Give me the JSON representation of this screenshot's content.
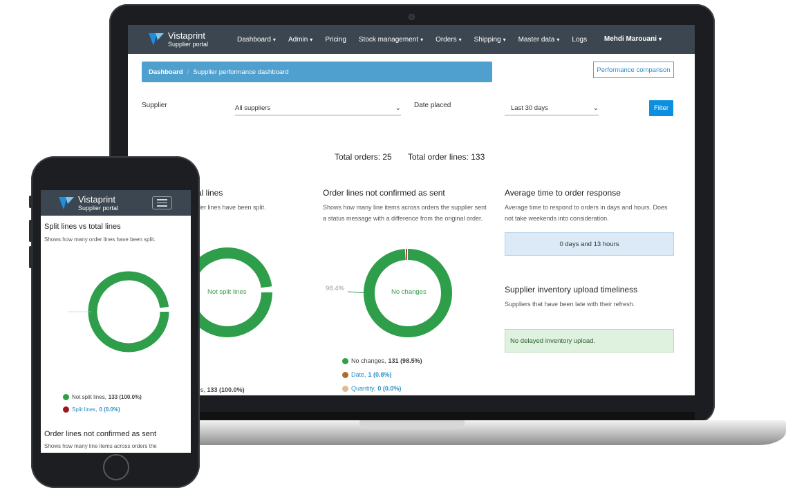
{
  "brand": {
    "name": "Vistaprint",
    "sub": "Supplier portal"
  },
  "nav": {
    "items": [
      {
        "label": "Dashboard",
        "dropdown": true
      },
      {
        "label": "Admin",
        "dropdown": true
      },
      {
        "label": "Pricing",
        "dropdown": false
      },
      {
        "label": "Stock management",
        "dropdown": true
      },
      {
        "label": "Orders",
        "dropdown": true
      },
      {
        "label": "Shipping",
        "dropdown": true
      },
      {
        "label": "Master data",
        "dropdown": true
      },
      {
        "label": "Logs",
        "dropdown": false
      }
    ],
    "user": "Mehdi Marouani"
  },
  "breadcrumb": {
    "root": "Dashboard",
    "separator": "/",
    "current": "Supplier performance dashboard"
  },
  "perf_button": "Performance comparison",
  "filters": {
    "supplier_label": "Supplier",
    "supplier_value": "All suppliers",
    "date_label": "Date placed",
    "date_value": "Last 30 days",
    "filter_button": "Filter"
  },
  "totals": {
    "orders": "Total orders: 25",
    "order_lines": "Total order lines: 133"
  },
  "split_card": {
    "title_partial": "al lines",
    "desc_partial": "der lines have been split.",
    "donut_label": "Not split lines",
    "legend_partial_prefix": "es,",
    "legend_partial_value": "133 (100.0%)"
  },
  "changes_card": {
    "title": "Order lines not confirmed as sent",
    "desc_line1": "Shows how many line items across orders the supplier sent",
    "desc_line2": "a status message with a difference from the original order.",
    "donut_label": "No changes",
    "pct_label": "98.4%",
    "legend": [
      {
        "label": "No changes,",
        "value": "131 (98.5%)",
        "color": "#2f9e4a",
        "link": false
      },
      {
        "label": "Date,",
        "value": "1 (0.8%)",
        "color": "#b06a2a",
        "link": true
      },
      {
        "label": "Quantity,",
        "value": "0 (0.0%)",
        "color": "#e3b98e",
        "link": true
      }
    ],
    "chart_data": {
      "type": "pie",
      "categories": [
        "No changes",
        "Date",
        "Quantity"
      ],
      "values": [
        131,
        1,
        0
      ]
    }
  },
  "response_card": {
    "title": "Average time to order response",
    "desc_line1": "Average time to respond to orders in days and hours. Does",
    "desc_line2": "not take weekends into consideration.",
    "value": "0 days and 13 hours"
  },
  "inventory_card": {
    "title": "Supplier inventory upload timeliness",
    "desc": "Suppliers that have been late with their refresh.",
    "status": "No delayed inventory upload."
  },
  "mobile": {
    "split_title": "Split lines vs total lines",
    "split_desc": "Shows how many order lines have been split.",
    "legend": [
      {
        "label": "Not split lines,",
        "value": "133 (100.0%)",
        "color": "#2f9e4a",
        "link": false
      },
      {
        "label": "Split lines,",
        "value": "0 (0.0%)",
        "color": "#a3141e",
        "link": true
      }
    ],
    "next_title": "Order lines not confirmed as sent",
    "next_desc": "Shows how many line items across orders the",
    "chart_data": {
      "type": "pie",
      "categories": [
        "Not split lines",
        "Split lines"
      ],
      "values": [
        133,
        0
      ]
    }
  },
  "colors": {
    "navbar": "#3b4650",
    "accent": "#0d8fe0",
    "green": "#2f9e4a",
    "breadcrumb": "#4fa0cf"
  }
}
